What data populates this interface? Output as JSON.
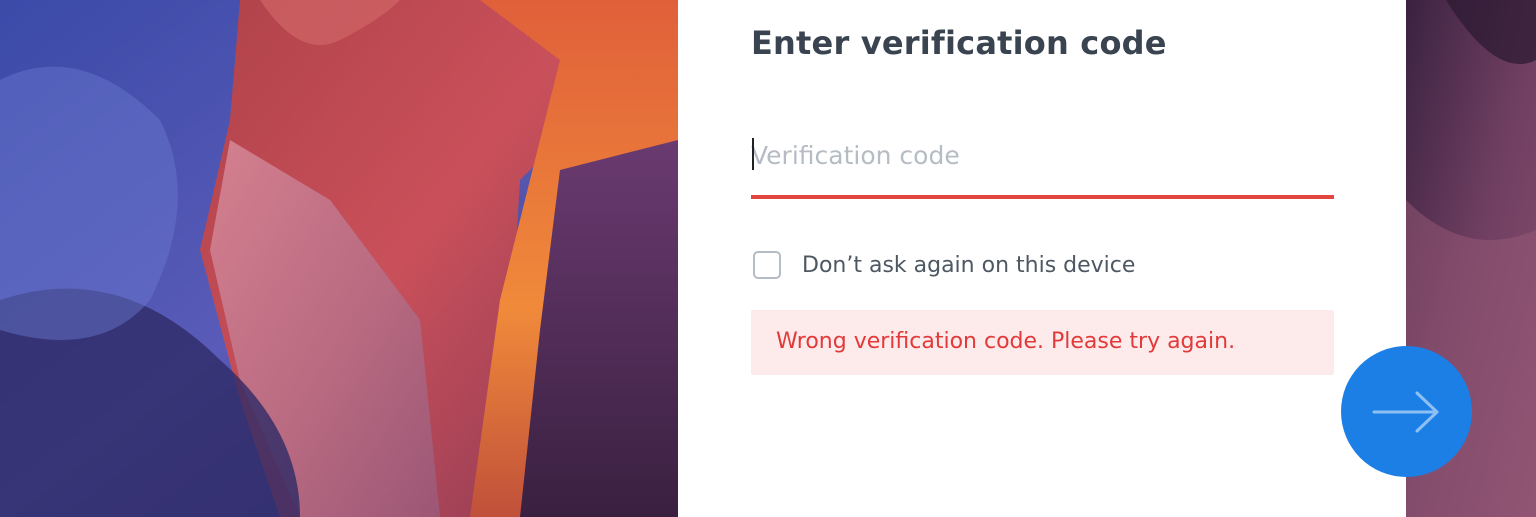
{
  "form": {
    "title": "Enter verification code",
    "code_placeholder": "Verification code",
    "remember_label": "Don’t ask again on this device",
    "error_message": "Wrong verification code. Please try again."
  },
  "submit": {
    "icon": "arrow-right-icon"
  },
  "colors": {
    "title": "#3a4350",
    "underline_error": "#e3453f",
    "error_background": "#fdeaea",
    "error_text": "#e23a3a",
    "submit_button": "#1b7fe6"
  }
}
